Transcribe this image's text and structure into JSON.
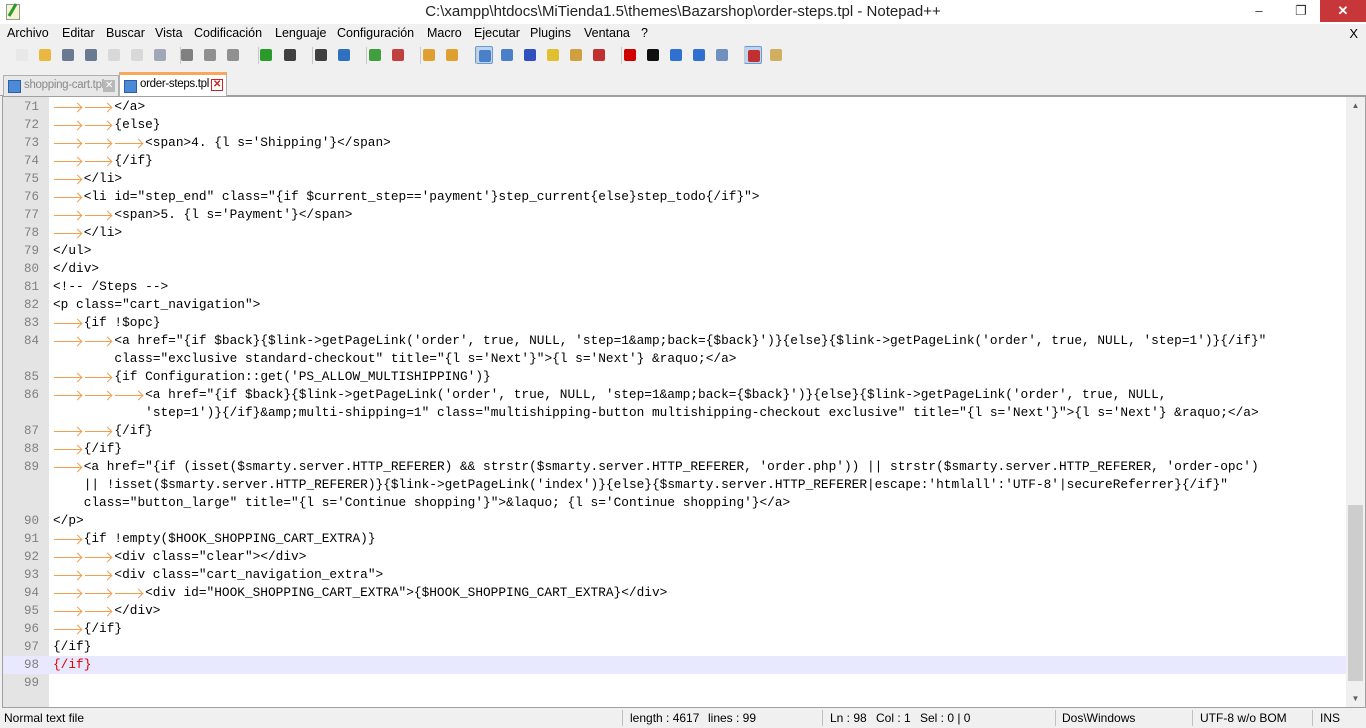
{
  "window": {
    "title": "C:\\xampp\\htdocs\\MiTienda1.5\\themes\\Bazarshop\\order-steps.tpl - Notepad++",
    "minimize": "–",
    "maximize": "❐",
    "close": "✕"
  },
  "menu": [
    "Archivo",
    "Editar",
    "Buscar",
    "Vista",
    "Codificación",
    "Lenguaje",
    "Configuración",
    "Macro",
    "Ejecutar",
    "Plugins",
    "Ventana",
    "?"
  ],
  "menu_close": "X",
  "toolbar": [
    "new",
    "open",
    "save",
    "save-all",
    "close",
    "close-all",
    "print",
    "cut",
    "copy",
    "paste",
    "undo",
    "redo",
    "find",
    "replace",
    "zoom-in",
    "zoom-out",
    "sync-vertical",
    "sync-horizontal",
    "word-wrap",
    "show-all-chars",
    "indent-guide",
    "user-defined-language",
    "document-map",
    "function-list",
    "record-macro",
    "stop-record",
    "play-macro",
    "run-macro-multiple",
    "save-macro",
    "spell-check",
    "plugin"
  ],
  "tabs": [
    {
      "label": "shopping-cart.tpl",
      "active": false
    },
    {
      "label": "order-steps.tpl",
      "active": true
    }
  ],
  "lines": [
    {
      "n": "71",
      "tabs": 2,
      "text": "</a>"
    },
    {
      "n": "72",
      "tabs": 2,
      "text": "{else}"
    },
    {
      "n": "73",
      "tabs": 3,
      "text": "<span>4. {l s='Shipping'}</span>"
    },
    {
      "n": "74",
      "tabs": 2,
      "text": "{/if}"
    },
    {
      "n": "75",
      "tabs": 1,
      "text": "</li>"
    },
    {
      "n": "76",
      "tabs": 1,
      "text": "<li id=\"step_end\" class=\"{if $current_step=='payment'}step_current{else}step_todo{/if}\">"
    },
    {
      "n": "77",
      "tabs": 2,
      "text": "<span>5. {l s='Payment'}</span>"
    },
    {
      "n": "78",
      "tabs": 1,
      "text": "</li>"
    },
    {
      "n": "79",
      "tabs": 0,
      "text": "</ul>"
    },
    {
      "n": "80",
      "tabs": 0,
      "text": "</div>"
    },
    {
      "n": "81",
      "tabs": 0,
      "text": "<!-- /Steps -->"
    },
    {
      "n": "82",
      "tabs": 0,
      "text": "<p class=\"cart_navigation\">"
    },
    {
      "n": "83",
      "tabs": 1,
      "text": "{if !$opc}"
    },
    {
      "n": "84",
      "tabs": 2,
      "text": "<a href=\"{if $back}{$link->getPageLink('order', true, NULL, 'step=1&amp;back={$back}')}{else}{$link->getPageLink('order', true, NULL, 'step=1')}{/if}\"",
      "cont": [
        "class=\"exclusive standard-checkout\" title=\"{l s='Next'}\">{l s='Next'} &raquo;</a>"
      ]
    },
    {
      "n": "85",
      "tabs": 2,
      "text": "{if Configuration::get('PS_ALLOW_MULTISHIPPING')}"
    },
    {
      "n": "86",
      "tabs": 3,
      "text": "<a href=\"{if $back}{$link->getPageLink('order', true, NULL, 'step=1&amp;back={$back}')}{else}{$link->getPageLink('order', true, NULL,",
      "cont": [
        "'step=1')}{/if}&amp;multi-shipping=1\" class=\"multishipping-button multishipping-checkout exclusive\" title=\"{l s='Next'}\">{l s='Next'} &raquo;</a>"
      ]
    },
    {
      "n": "87",
      "tabs": 2,
      "text": "{/if}"
    },
    {
      "n": "88",
      "tabs": 1,
      "text": "{/if}"
    },
    {
      "n": "89",
      "tabs": 1,
      "text": "<a href=\"{if (isset($smarty.server.HTTP_REFERER) && strstr($smarty.server.HTTP_REFERER, 'order.php')) || strstr($smarty.server.HTTP_REFERER, 'order-opc')",
      "cont": [
        "|| !isset($smarty.server.HTTP_REFERER)}{$link->getPageLink('index')}{else}{$smarty.server.HTTP_REFERER|escape:'htmlall':'UTF-8'|secureReferrer}{/if}\"",
        "class=\"button_large\" title=\"{l s='Continue shopping'}\">&laquo; {l s='Continue shopping'}</a>"
      ]
    },
    {
      "n": "90",
      "tabs": 0,
      "text": "</p>"
    },
    {
      "n": "91",
      "tabs": 1,
      "text": "{if !empty($HOOK_SHOPPING_CART_EXTRA)}"
    },
    {
      "n": "92",
      "tabs": 2,
      "text": "<div class=\"clear\"></div>"
    },
    {
      "n": "93",
      "tabs": 2,
      "text": "<div class=\"cart_navigation_extra\">"
    },
    {
      "n": "94",
      "tabs": 3,
      "text": "<div id=\"HOOK_SHOPPING_CART_EXTRA\">{$HOOK_SHOPPING_CART_EXTRA}</div>"
    },
    {
      "n": "95",
      "tabs": 2,
      "text": "</div>"
    },
    {
      "n": "96",
      "tabs": 1,
      "text": "{/if}"
    },
    {
      "n": "97",
      "tabs": 0,
      "text": "{/if}"
    },
    {
      "n": "98",
      "tabs": 0,
      "text": "{/if}",
      "current": true
    },
    {
      "n": "99",
      "tabs": 0,
      "text": ""
    }
  ],
  "status": {
    "type": "Normal text file",
    "length": "length : 4617",
    "lines": "lines : 99",
    "ln": "Ln : 98",
    "col": "Col : 1",
    "sel": "Sel : 0 | 0",
    "eol": "Dos\\Windows",
    "encoding": "UTF-8 w/o BOM",
    "mode": "INS"
  }
}
